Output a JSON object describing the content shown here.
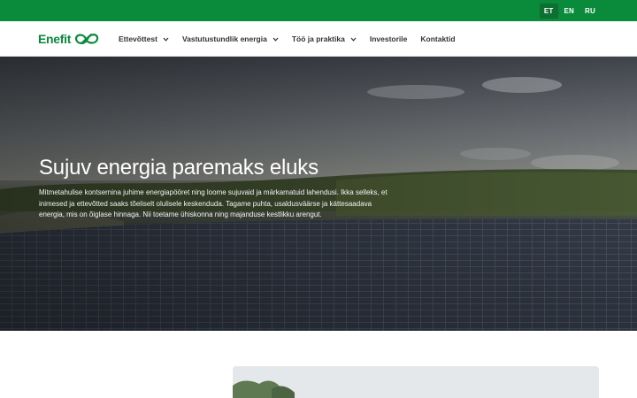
{
  "languages": [
    {
      "code": "ET",
      "active": true
    },
    {
      "code": "EN",
      "active": false
    },
    {
      "code": "RU",
      "active": false
    }
  ],
  "brand": {
    "name": "Enefit",
    "accent_color": "#0a8a3b",
    "logo_icon": "enefit-swirl-icon"
  },
  "nav": {
    "items": [
      {
        "label": "Ettevõttest",
        "has_dropdown": true
      },
      {
        "label": "Vastutustundlik energia",
        "has_dropdown": true
      },
      {
        "label": "Töö ja praktika",
        "has_dropdown": true
      },
      {
        "label": "Investorile",
        "has_dropdown": false
      },
      {
        "label": "Kontaktid",
        "has_dropdown": false
      }
    ],
    "dropdown_icon": "chevron-down-icon"
  },
  "hero": {
    "title": "Sujuv energia paremaks eluks",
    "text": "Mitmetahulise kontsernina juhime energiapööret ning loome sujuvaid ja märkamatuid lahendusi. Ikka selleks, et inimesed ja ettevõtted saaks tõeliselt olulisele keskenduda. Tagame puhta, usaldusväärse ja kättesaadava energia, mis on õiglase hinnaga. Nii toetame ühiskonna ning majanduse kestlikku arengut."
  }
}
